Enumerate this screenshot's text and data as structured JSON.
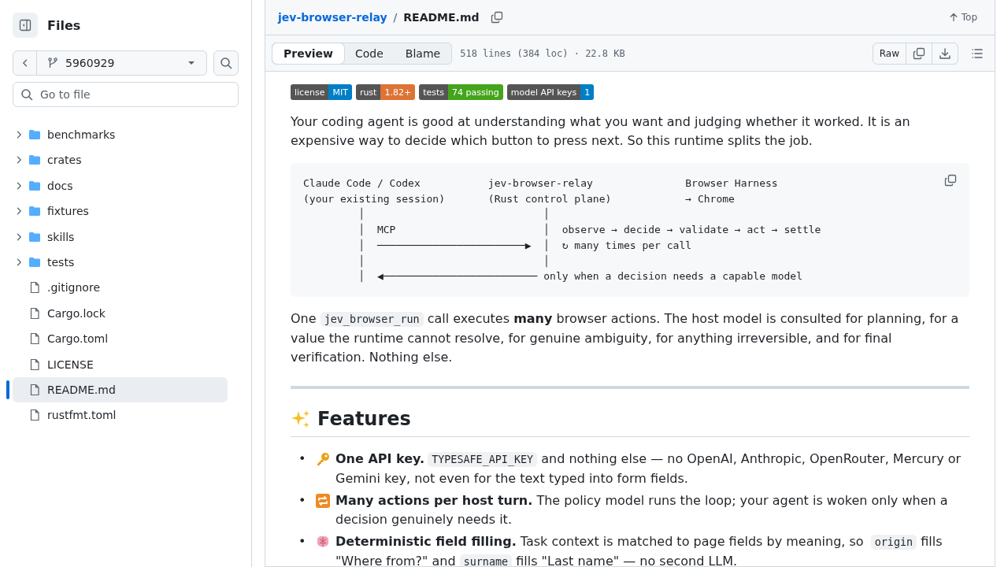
{
  "sidebar": {
    "title": "Files",
    "branch": "5960929",
    "search": {
      "placeholder": "Go to file"
    },
    "tree": [
      {
        "kind": "folder",
        "name": "benchmarks",
        "expanded": false,
        "selected": false
      },
      {
        "kind": "folder",
        "name": "crates",
        "expanded": false,
        "selected": false
      },
      {
        "kind": "folder",
        "name": "docs",
        "expanded": false,
        "selected": false
      },
      {
        "kind": "folder",
        "name": "fixtures",
        "expanded": false,
        "selected": false
      },
      {
        "kind": "folder",
        "name": "skills",
        "expanded": false,
        "selected": false
      },
      {
        "kind": "folder",
        "name": "tests",
        "expanded": false,
        "selected": false
      },
      {
        "kind": "file",
        "name": ".gitignore",
        "selected": false
      },
      {
        "kind": "file",
        "name": "Cargo.lock",
        "selected": false
      },
      {
        "kind": "file",
        "name": "Cargo.toml",
        "selected": false
      },
      {
        "kind": "file",
        "name": "LICENSE",
        "selected": false
      },
      {
        "kind": "file",
        "name": "README.md",
        "selected": true
      },
      {
        "kind": "file",
        "name": "rustfmt.toml",
        "selected": false
      }
    ]
  },
  "breadcrumb": {
    "repo": "jev-browser-relay",
    "separator": "/",
    "file": "README.md",
    "top": "Top"
  },
  "toolbar": {
    "tabs": [
      {
        "label": "Preview",
        "selected": true
      },
      {
        "label": "Code",
        "selected": false
      },
      {
        "label": "Blame",
        "selected": false
      }
    ],
    "meta": "518 lines (384 loc) · 22.8 KB",
    "raw": "Raw"
  },
  "badges": [
    {
      "label": "license",
      "value": "MIT",
      "color": "#007ec6"
    },
    {
      "label": "rust",
      "value": "1.82+",
      "color": "#dd7435"
    },
    {
      "label": "tests",
      "value": "74 passing",
      "color": "#44a51c"
    },
    {
      "label": "model API keys",
      "value": "1",
      "color": "#007ec6"
    }
  ],
  "intro": "Your coding agent is good at understanding what you want and judging whether it worked. It is an expensive way to decide which button to press next. So this runtime splits the job.",
  "code_block": [
    "Claude Code / Codex           jev-browser-relay               Browser Harness",
    "(your existing session)       (Rust control plane)            → Chrome",
    "         │                             │",
    "         │  MCP                        │  observe → decide → validate → act → settle",
    "         │  ────────────────────────▶  │  ↻ many times per call",
    "         │                             │",
    "         │  ◀───────────────────────── only when a decision needs a capable model"
  ],
  "summary": [
    {
      "kind": "text",
      "text": "One "
    },
    {
      "kind": "code",
      "text": "jev_browser_run"
    },
    {
      "kind": "text",
      "text": " call executes "
    },
    {
      "kind": "bold",
      "text": "many"
    },
    {
      "kind": "text",
      "text": " browser actions. The host model is consulted for planning, for a value the runtime cannot resolve, for genuine ambiguity, for anything irreversible, and for final verification. Nothing else."
    }
  ],
  "features": {
    "heading": "Features",
    "items": [
      {
        "marker": "•",
        "parts": [
          {
            "kind": "bold",
            "text": "One API key."
          },
          {
            "kind": "code",
            "text": "TYPESAFE_API_KEY"
          },
          {
            "kind": "text",
            "text": " and nothing else — no OpenAI, Anthropic, OpenRouter, Mercury or Gemini key, not even for the text typed into form fields."
          }
        ]
      },
      {
        "marker": "•",
        "parts": [
          {
            "kind": "bold",
            "text": "Many actions per host turn."
          },
          {
            "kind": "text",
            "text": " The policy model runs the loop; your agent is woken only when a decision genuinely needs it."
          }
        ]
      },
      {
        "marker": "•",
        "parts": [
          {
            "kind": "bold",
            "text": "Deterministic field filling."
          },
          {
            "kind": "text",
            "text": " Task context is matched to page fields by meaning, so "
          },
          {
            "kind": "code",
            "text": "origin"
          },
          {
            "kind": "text",
            "text": " fills \"Where from?\" and "
          },
          {
            "kind": "code",
            "text": "surname"
          },
          {
            "kind": "text",
            "text": " fills \"Last name\" — no second LLM."
          }
        ]
      }
    ]
  }
}
